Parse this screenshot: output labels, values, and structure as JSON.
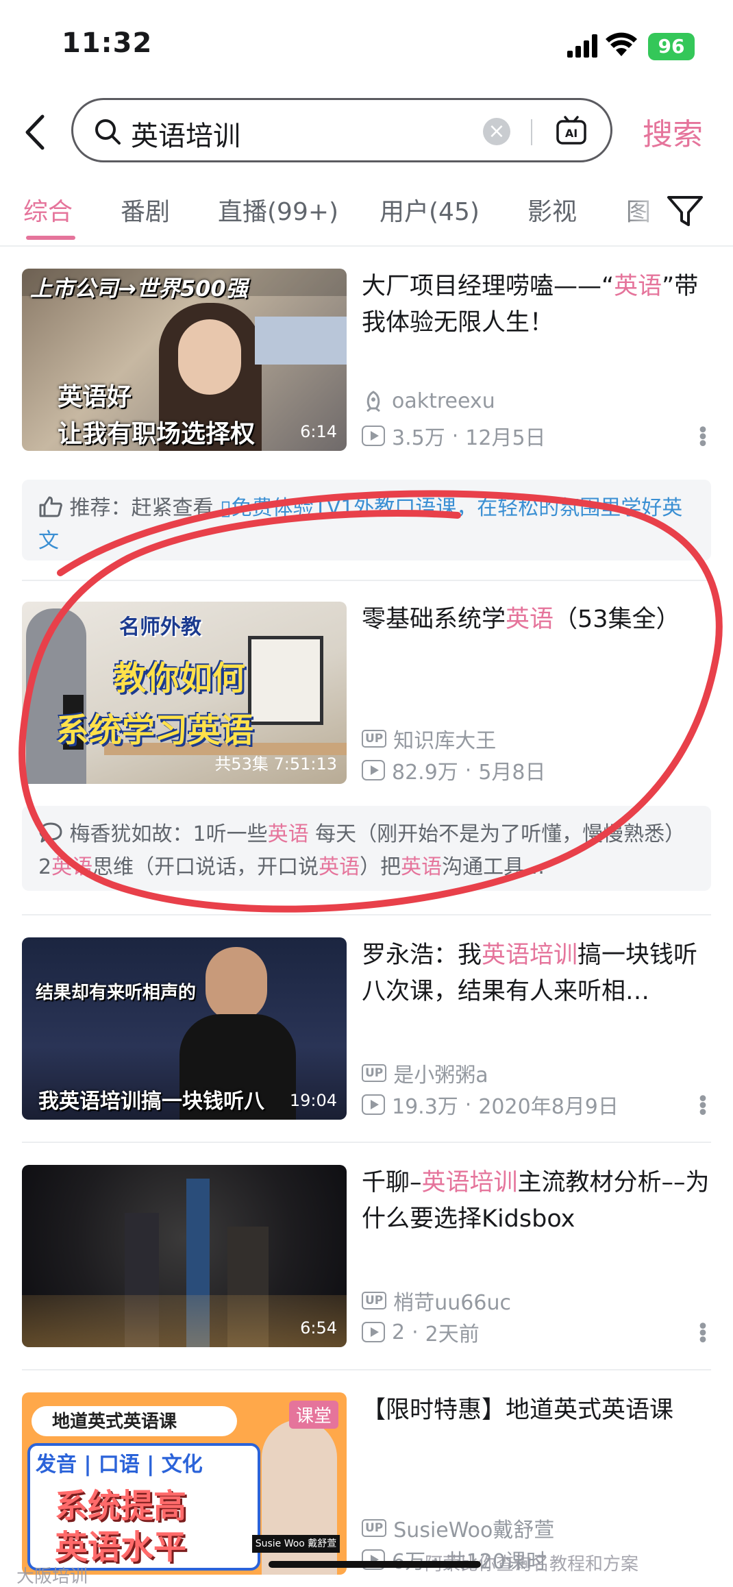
{
  "status": {
    "time": "11:32",
    "battery": "96"
  },
  "search": {
    "query": "英语培训",
    "search_label": "搜索"
  },
  "tabs": [
    "综合",
    "番剧",
    "直播(99+)",
    "用户(45)",
    "影视",
    "图"
  ],
  "videos": [
    {
      "thumb_text_top": "上市公司→世界500强",
      "thumb_text_1": "英语好",
      "thumb_text_2": "让我有职场选择权",
      "duration": "6:14",
      "title_pre": "大厂项目经理唠嗑——“",
      "title_hl": "英语",
      "title_post": "”带我体验无限人生！",
      "author": "oaktreexu",
      "views": "3.5万",
      "date": "12月5日"
    },
    {
      "thumb_text_top": "名师外教",
      "thumb_text_1": "教你如何",
      "thumb_text_2": "系统学习英语",
      "duration": "共53集 7:51:13",
      "title_pre": "零基础系统学",
      "title_hl": "英语",
      "title_post": "（53集全）",
      "author": "知识库大王",
      "views": "82.9万",
      "date": "5月8日"
    },
    {
      "thumb_text_1": "结果却有来听相声的",
      "thumb_text_2": "我英语培训搞一块钱听八",
      "duration": "19:04",
      "title_pre": "罗永浩：我",
      "title_hl": "英语培训",
      "title_post": "搞一块钱听八次课，结果有人来听相…",
      "author": "是小粥粥a",
      "views": "19.3万",
      "date": "2020年8月9日"
    },
    {
      "duration": "6:54",
      "title_pre": "千聊–",
      "title_hl": "英语培训",
      "title_post": "主流教材分析––为什么要选择Kidsbox",
      "author": "梢苛uu66uc",
      "views": "2",
      "date": "2天前"
    },
    {
      "thumb_text_top": "地道英式英语课",
      "thumb_text_mid": "发音 | 口语 | 文化",
      "thumb_text_1": "系统提高",
      "thumb_text_2": "英语水平",
      "thumb_badge": "课堂",
      "thumb_name": "Susie Woo 戴舒萱",
      "title_pre": "【限时特惠】地道英式英语课",
      "title_hl": "",
      "title_post": "",
      "author": "SusieWoo戴舒萱",
      "views": "6万",
      "date": "共120课时"
    }
  ],
  "rec1": {
    "prefix": "推荐：赶紧查看",
    "link": "免费体验1V1外教口语课，在轻松的氛围里学好英文"
  },
  "rec2": {
    "user": "梅香犹如故：",
    "p1": "1听一些",
    "h1": "英语",
    "p2": " 每天（刚开始不是为了听懂，慢慢熟悉） 2",
    "h2": "英语",
    "p3": "思维（开口说话，开口说",
    "h3": "英语",
    "p4": "）把",
    "h4": "英语",
    "p5": "沟通工具…"
  },
  "watermarks": {
    "left": "大阪培训",
    "right": "阿荣比你查询名教程和方案"
  },
  "colors": {
    "accent": "#e5749b",
    "link": "#3a8fd3",
    "annotation": "#e8404a"
  }
}
